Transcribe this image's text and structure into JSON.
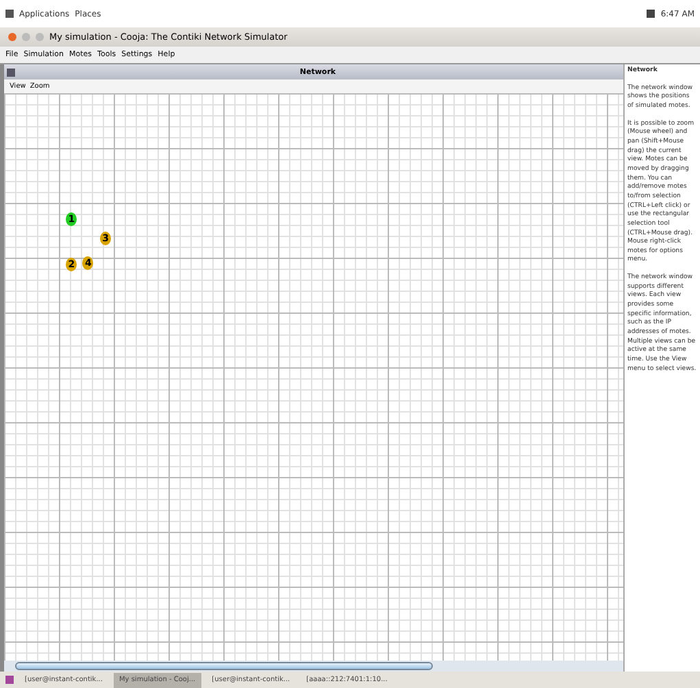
{
  "top_panel": {
    "menus": [
      "Applications",
      "Places"
    ],
    "clock": "6:47 AM"
  },
  "window": {
    "title": "My simulation - Cooja: The Contiki Network Simulator"
  },
  "menu_bar": [
    "File",
    "Simulation",
    "Motes",
    "Tools",
    "Settings",
    "Help"
  ],
  "network": {
    "title": "Network",
    "menus": [
      "View",
      "Zoom"
    ],
    "motes": [
      {
        "label": "1",
        "color": "#22cc22"
      },
      {
        "label": "3",
        "color": "#d9a400"
      },
      {
        "label": "2",
        "color": "#d9a400"
      },
      {
        "label": "4",
        "color": "#d9a400"
      }
    ]
  },
  "help_panel": {
    "title": "Network",
    "paragraphs": [
      "The network window shows the positions of simulated motes.",
      "It is possible to zoom (Mouse wheel) and pan (Shift+Mouse drag) the current view. Motes can be moved by dragging them. You can add/remove motes to/from selection (CTRL+Left click) or use the rectangular selection tool (CTRL+Mouse drag). Mouse right-click motes for options menu.",
      "The network window supports different views. Each view provides some specific information, such as the IP addresses of motes. Multiple views can be active at the same time. Use the View menu to select views."
    ]
  },
  "taskbar": [
    {
      "label": "[user@instant-contik...",
      "selected": false
    },
    {
      "label": "My simulation - Cooj...",
      "selected": true
    },
    {
      "label": "[user@instant-contik...",
      "selected": false
    },
    {
      "label": "[aaaa::212:7401:1:10...",
      "selected": false
    }
  ]
}
